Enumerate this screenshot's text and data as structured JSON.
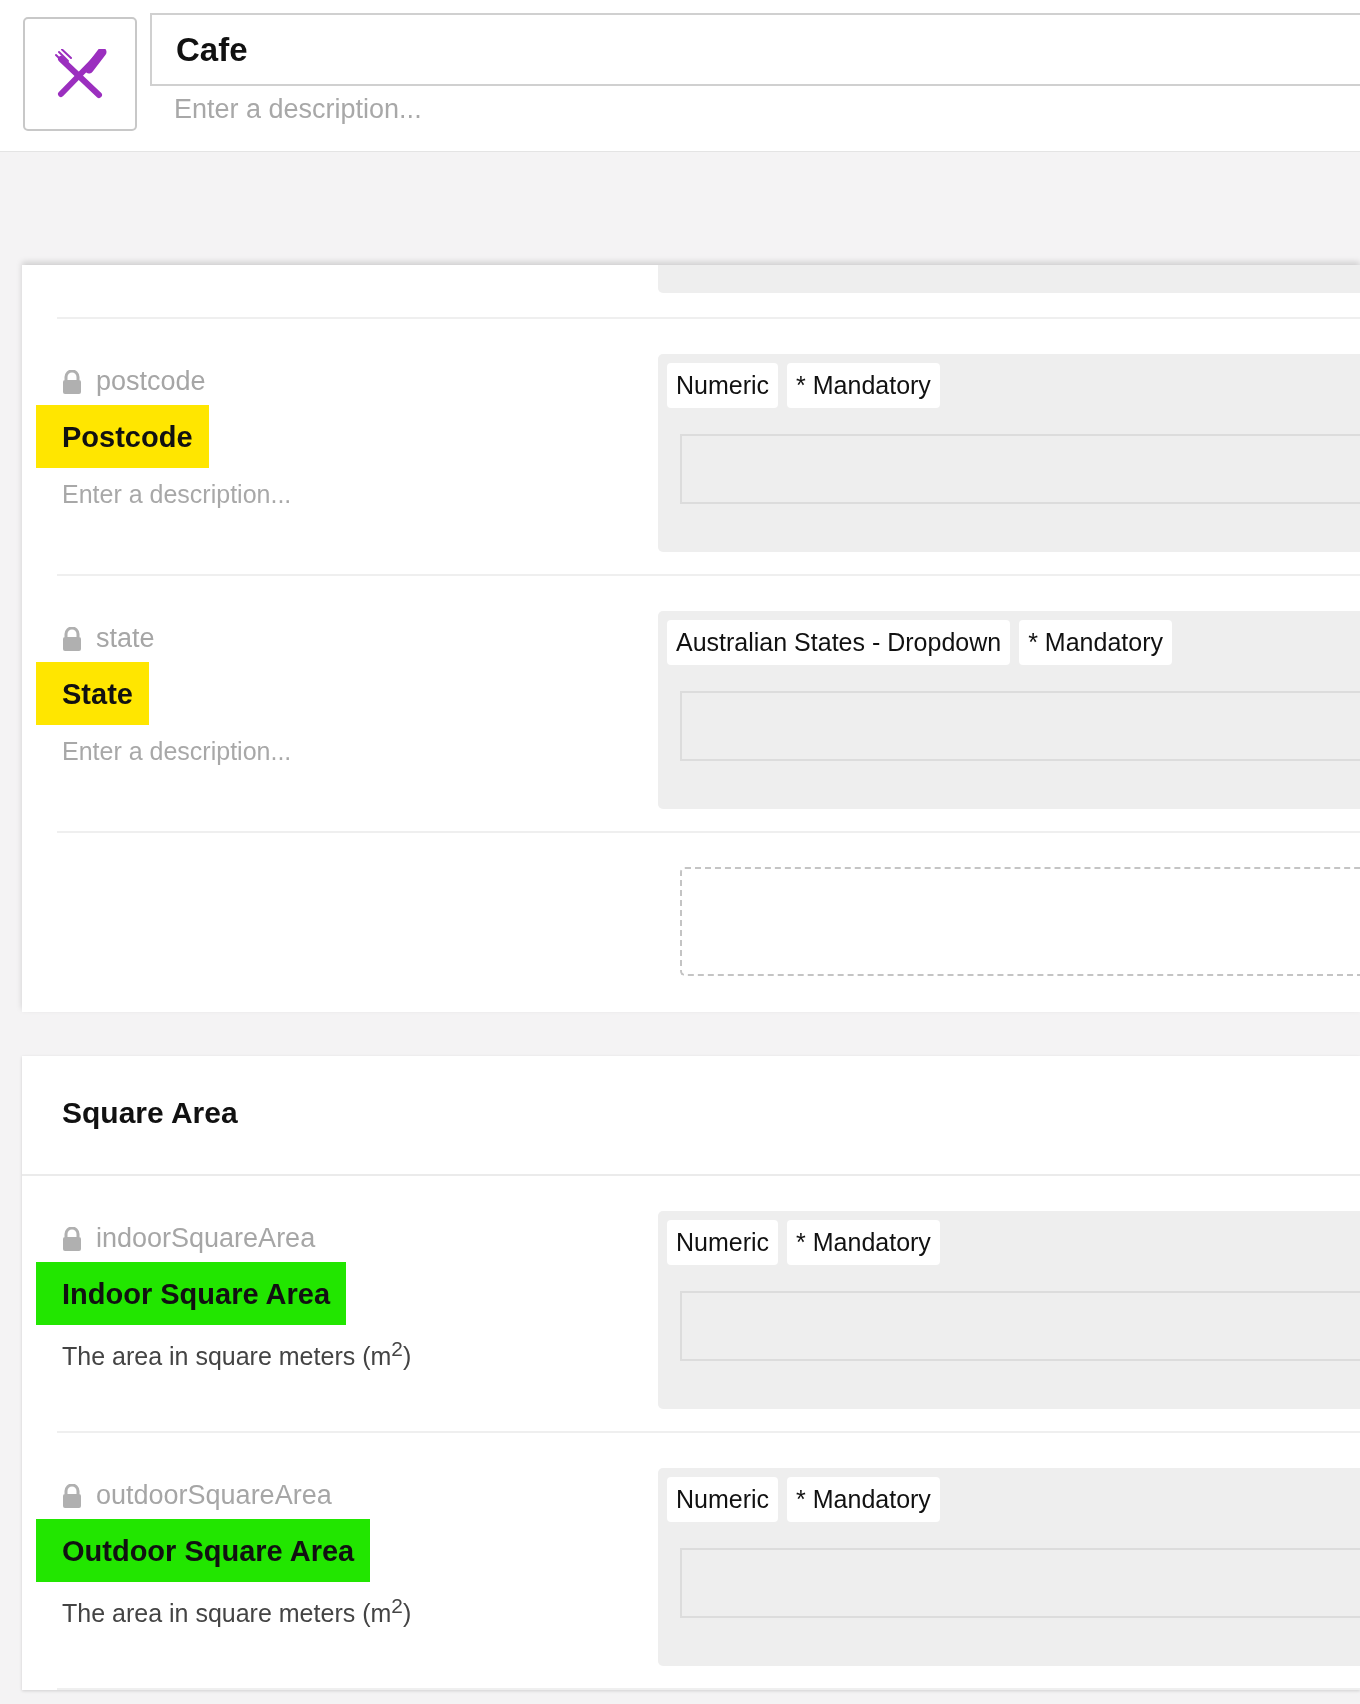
{
  "header": {
    "title": "Cafe",
    "placeholder": "Enter a description..."
  },
  "groups": [
    {
      "continued_from_above": true,
      "drop_zone": true,
      "properties": [
        {
          "alias": "postcode",
          "label": "Postcode",
          "color": "#ffe600",
          "placeholder": "Enter a description...",
          "tags": [
            "Numeric",
            "* Mandatory"
          ]
        },
        {
          "alias": "state",
          "label": "State",
          "color": "#ffe600",
          "placeholder": "Enter a description...",
          "tags": [
            "Australian States - Dropdown",
            "* Mandatory"
          ]
        }
      ]
    },
    {
      "title": "Square Area",
      "properties": [
        {
          "alias": "indoorSquareArea",
          "label": "Indoor Square Area",
          "color": "#22e600",
          "description": "The area in square meters (m$^{2}$)",
          "tags": [
            "Numeric",
            "* Mandatory"
          ]
        },
        {
          "alias": "outdoorSquareArea",
          "label": "Outdoor Square Area",
          "color": "#22e600",
          "description": "The area in square meters (m$^{2}$)",
          "tags": [
            "Numeric",
            "* Mandatory"
          ]
        }
      ]
    }
  ]
}
